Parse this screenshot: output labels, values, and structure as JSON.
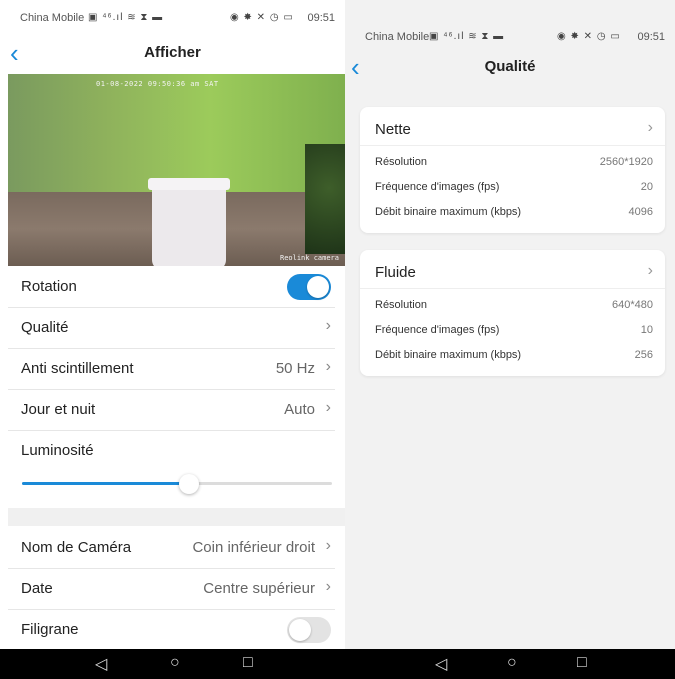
{
  "left": {
    "status": {
      "carrier": "China Mobile",
      "icons": "▣ ⁴⁶.ıl ≋ ⧗ ▬",
      "right_icons": "◉ ✸ ✕ ◷ ▭",
      "time": "09:51"
    },
    "title": "Afficher",
    "preview": {
      "timestamp": "01-08-2022 09:50:36 am SAT",
      "watermark": "Reolink camera"
    },
    "rows": [
      {
        "label": "Rotation",
        "toggle": "on"
      },
      {
        "label": "Qualité",
        "value": ""
      },
      {
        "label": "Anti scintillement",
        "value": "50 Hz"
      },
      {
        "label": "Jour et nuit",
        "value": "Auto"
      }
    ],
    "brightness": {
      "label": "Luminosité",
      "level": 0.54
    },
    "rows2": [
      {
        "label": "Nom de Caméra",
        "value": "Coin inférieur droit"
      },
      {
        "label": "Date",
        "value": "Centre supérieur"
      },
      {
        "label": "Filigrane",
        "toggle": "off"
      }
    ]
  },
  "right": {
    "status": {
      "carrier": "China Mobile",
      "icons": "▣ ⁴⁶.ıl ≋ ⧗ ▬",
      "right_icons": "◉ ✸ ✕ ◷ ▭",
      "time": "09:51"
    },
    "title": "Qualité",
    "cards": [
      {
        "title": "Nette",
        "items": [
          {
            "key": "Résolution",
            "value": "2560*1920"
          },
          {
            "key": "Fréquence d'images (fps)",
            "value": "20"
          },
          {
            "key": "Débit binaire maximum (kbps)",
            "value": "4096"
          }
        ]
      },
      {
        "title": "Fluide",
        "items": [
          {
            "key": "Résolution",
            "value": "640*480"
          },
          {
            "key": "Fréquence d'images (fps)",
            "value": "10"
          },
          {
            "key": "Débit binaire maximum (kbps)",
            "value": "256"
          }
        ]
      }
    ]
  },
  "icons": {
    "back": "back-chevron-icon",
    "chevron": "chevron-right-icon",
    "nav_back": "nav-back-icon",
    "nav_home": "nav-home-icon",
    "nav_recent": "nav-recent-icon"
  },
  "colors": {
    "accent": "#1a8ad8"
  }
}
